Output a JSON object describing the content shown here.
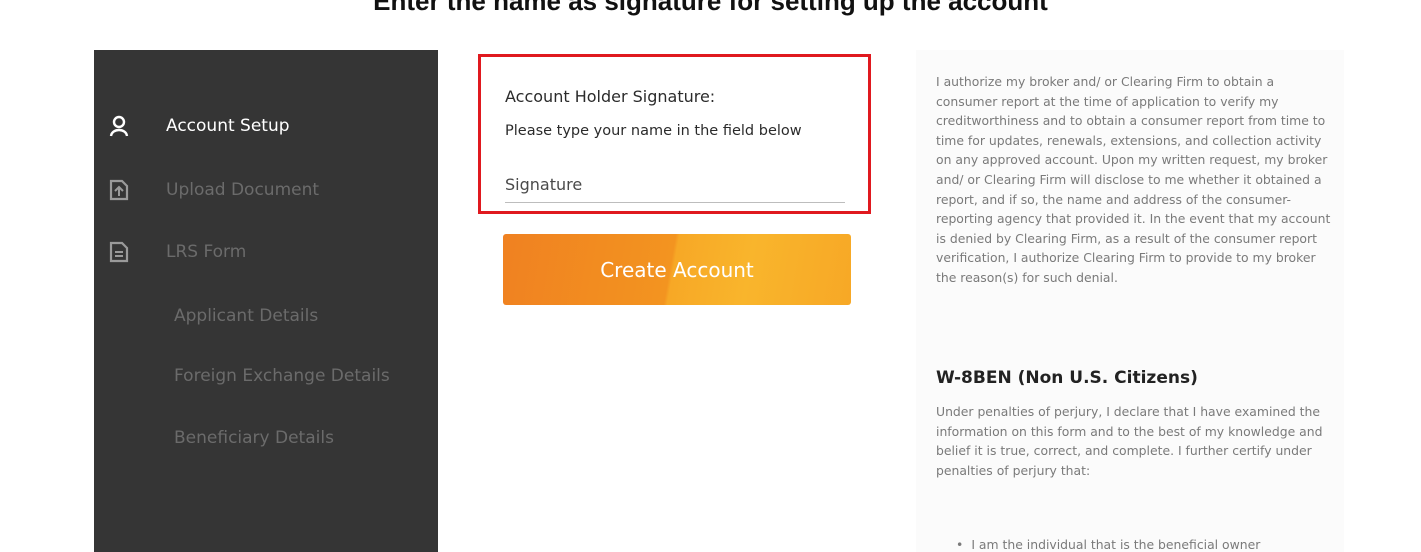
{
  "banner": {
    "text": "Enter the name as signature for setting up the account"
  },
  "sidebar": {
    "items": [
      {
        "label": "Account Setup",
        "icon": "user-icon",
        "active": true
      },
      {
        "label": "Upload Document",
        "icon": "upload-icon",
        "active": false
      },
      {
        "label": "LRS Form",
        "icon": "document-icon",
        "active": false
      },
      {
        "label": "Applicant Details"
      },
      {
        "label": "Foreign Exchange Details"
      },
      {
        "label": "Beneficiary Details"
      }
    ]
  },
  "signature": {
    "title": "Account Holder Signature:",
    "hint": "Please type your name in the field below",
    "placeholder": "Signature",
    "value": "",
    "highlight_color": "#e0191f"
  },
  "create_button": {
    "label": "Create Account"
  },
  "legal": {
    "authorization_text": "I authorize my broker and/ or Clearing Firm to obtain a consumer report at the time of application to verify my creditworthiness and to obtain a consumer report from time to time for updates, renewals, extensions, and collection activity on any approved account. Upon my written request, my broker and/ or Clearing Firm will disclose to me whether it obtained a report, and if so, the name and address of the consumer-reporting agency that provided it. In the event that my account is denied by Clearing Firm, as a result of the consumer report verification, I authorize Clearing Firm to provide to my broker the reason(s) for such denial.",
    "w8ben_heading": "W-8BEN (Non U.S. Citizens)",
    "w8ben_text": "Under penalties of perjury, I declare that I have examined the information on this form and to the best of my knowledge and belief it is true, correct, and complete. I further certify under penalties of perjury that:",
    "w8ben_item_1": "I am the individual that is the beneficial owner"
  },
  "colors": {
    "sidebar_bg": "#353535",
    "accent_orange": "#f39420",
    "active_text": "#ffffff",
    "inactive_text": "#6b6b6b"
  }
}
